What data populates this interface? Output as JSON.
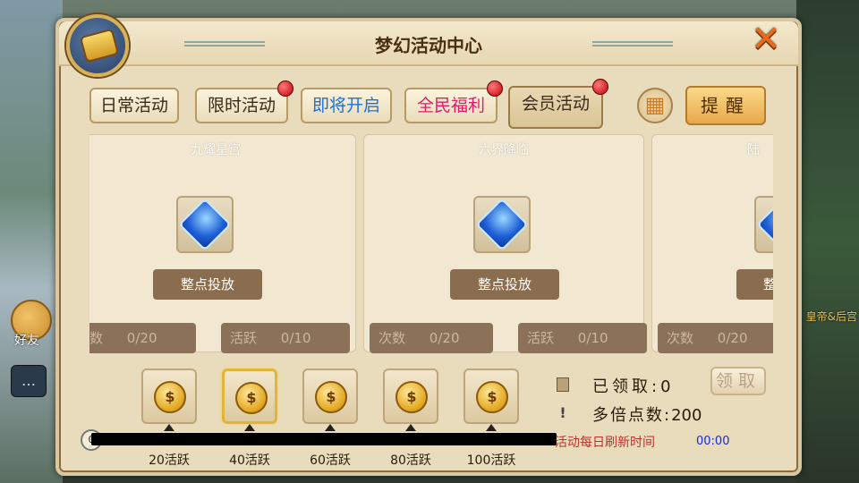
{
  "window": {
    "title": "梦幻活动中心"
  },
  "tabs": [
    {
      "label": "日常活动",
      "color": "#3a2a1a",
      "dot": false
    },
    {
      "label": "限时活动",
      "color": "#3a2a1a",
      "dot": true
    },
    {
      "label": "即将开启",
      "color": "#1e6fd8",
      "dot": false
    },
    {
      "label": "全民福利",
      "color": "#e21b6c",
      "dot": true
    },
    {
      "label": "会员活动",
      "color": "#3a2a1a",
      "dot": true
    }
  ],
  "active_tab": "会员活动",
  "remind_label": "提醒",
  "cards": [
    {
      "title": "九耀星宫",
      "schedule_label": "整点投放",
      "count_label": "次数",
      "count": "0/20",
      "active_label": "活跃",
      "active": "0/10"
    },
    {
      "title": "六界降临",
      "schedule_label": "整点投放",
      "count_label": "次数",
      "count": "0/20",
      "active_label": "活跃",
      "active": "0/10"
    },
    {
      "title": "陆",
      "schedule_label": "整",
      "count_label": "次数",
      "count": "0/20",
      "active_label": "",
      "active": ""
    }
  ],
  "rewards": [
    {
      "tier": "20活跃",
      "selected": false
    },
    {
      "tier": "40活跃",
      "selected": true
    },
    {
      "tier": "60活跃",
      "selected": false
    },
    {
      "tier": "80活跃",
      "selected": false
    },
    {
      "tier": "100活跃",
      "selected": false
    }
  ],
  "progress": {
    "start_value": "0",
    "fraction": 0
  },
  "info": {
    "claimed_label": "已领取:",
    "claimed_value": "0",
    "multiplier_label": "多倍点数:",
    "multiplier_value": "200",
    "claim_button": "领取",
    "refresh_label": "活动每日刷新时间",
    "refresh_time": "00:00"
  },
  "side": {
    "friends_label": "好友",
    "right_label": "皇帝&后宫"
  },
  "colors": {
    "accent": "#e76a1a",
    "panel": "#e9dcbc",
    "refresh_text": "#c0302a",
    "refresh_time": "#1a2ad0"
  }
}
